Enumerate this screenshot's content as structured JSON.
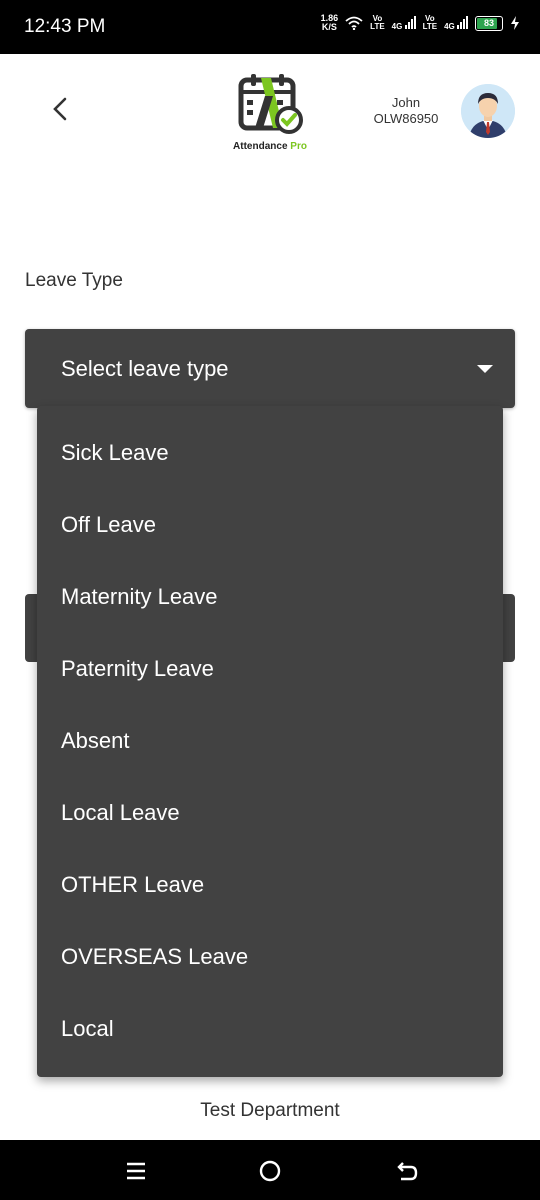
{
  "status_bar": {
    "time": "12:43 PM",
    "net_speed_value": "1.86",
    "net_speed_unit": "K/S",
    "sim1_vo": "Vo",
    "sim1_lte": "LTE",
    "sim1_net": "4G",
    "sim2_vo": "Vo",
    "sim2_lte": "LTE",
    "sim2_net": "4G",
    "battery": "83",
    "battery_color": "#2ea44f"
  },
  "header": {
    "logo_text": "Attendance",
    "logo_text_accent": "Pro",
    "logo_accent_color": "#7cc620",
    "user_name": "John",
    "user_id": "OLW86950"
  },
  "form": {
    "leave_type_label": "Leave Type",
    "leave_type_placeholder": "Select leave type",
    "department": "Test Department"
  },
  "dropdown": {
    "options": [
      "Sick Leave",
      "Off Leave",
      "Maternity Leave",
      "Paternity Leave",
      "Absent",
      "Local Leave",
      "OTHER Leave",
      "OVERSEAS Leave",
      "Local"
    ]
  },
  "nav": {
    "icons": [
      "menu-icon",
      "home-icon",
      "back-icon"
    ]
  }
}
